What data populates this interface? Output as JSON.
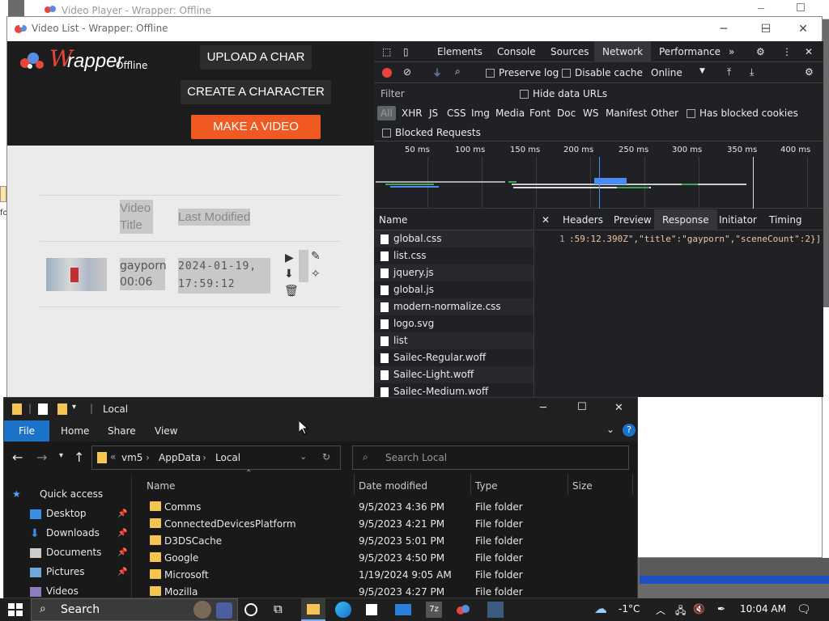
{
  "bg_window": {
    "title": "Video Player - Wrapper: Offline"
  },
  "main_window": {
    "title": "Video List - Wrapper: Offline",
    "minimize": "─",
    "maximize": "☐",
    "close": "✕"
  },
  "page": {
    "logo": {
      "w": "W",
      "rapper": "rapper",
      "offline": "Offline"
    },
    "buttons": {
      "upload": "UPLOAD A CHAR",
      "create": "CREATE A CHARACTER",
      "make": "MAKE A VIDEO"
    },
    "table": {
      "col_title": "Video Title",
      "col_modified": "Last Modified",
      "rows": [
        {
          "title": "gayporn",
          "duration": "00:06",
          "date": "2024-01-19,",
          "time": "17:59:12"
        }
      ]
    },
    "actions": {
      "play": "▶",
      "download": "⬇",
      "delete": "🗑",
      "edit": "✎",
      "magic": "✧"
    }
  },
  "devtools": {
    "tabs": [
      "Elements",
      "Console",
      "Sources",
      "Network",
      "Performance"
    ],
    "active_tab": "Network",
    "more": "»",
    "toolbar": {
      "preserve_log": "Preserve log",
      "disable_cache": "Disable cache",
      "throttle": "Online"
    },
    "filter": {
      "label": "Filter",
      "hide_data_urls": "Hide data URLs",
      "types": [
        "All",
        "XHR",
        "JS",
        "CSS",
        "Img",
        "Media",
        "Font",
        "Doc",
        "WS",
        "Manifest",
        "Other"
      ],
      "has_blocked_cookies": "Has blocked cookies",
      "blocked_requests": "Blocked Requests"
    },
    "timeline_ticks": [
      "50 ms",
      "100 ms",
      "150 ms",
      "200 ms",
      "250 ms",
      "300 ms",
      "350 ms",
      "400 ms"
    ],
    "list_header": "Name",
    "files": [
      "global.css",
      "list.css",
      "jquery.js",
      "global.js",
      "modern-normalize.css",
      "logo.svg",
      "list",
      "Sailec-Regular.woff",
      "Sailec-Light.woff",
      "Sailec-Medium.woff"
    ],
    "detail_tabs": [
      "Headers",
      "Preview",
      "Response",
      "Initiator",
      "Timing"
    ],
    "active_detail_tab": "Response",
    "response_line_no": "1",
    "response_text": ":59:12.390Z\",\"title\":\"gayporn\",\"sceneCount\":2}]"
  },
  "explorer": {
    "title": "Local",
    "ribbon": [
      "File",
      "Home",
      "Share",
      "View"
    ],
    "breadcrumb": [
      "vm5",
      "AppData",
      "Local"
    ],
    "search_placeholder": "Search Local",
    "nav": [
      "Quick access",
      "Desktop",
      "Downloads",
      "Documents",
      "Pictures",
      "Videos"
    ],
    "columns": [
      "Name",
      "Date modified",
      "Type",
      "Size"
    ],
    "rows": [
      {
        "name": "Comms",
        "date": "9/5/2023 4:36 PM",
        "type": "File folder"
      },
      {
        "name": "ConnectedDevicesPlatform",
        "date": "9/5/2023 4:21 PM",
        "type": "File folder"
      },
      {
        "name": "D3DSCache",
        "date": "9/5/2023 5:01 PM",
        "type": "File folder"
      },
      {
        "name": "Google",
        "date": "9/5/2023 4:50 PM",
        "type": "File folder"
      },
      {
        "name": "Microsoft",
        "date": "1/19/2024 9:05 AM",
        "type": "File folder"
      },
      {
        "name": "Mozilla",
        "date": "9/5/2023 4:27 PM",
        "type": "File folder"
      }
    ]
  },
  "taskbar": {
    "search": "Search",
    "weather": "-1°C",
    "time": "10:04 AM"
  },
  "colors": {
    "accent_orange": "#f05a22",
    "logo_red": "#e9453b",
    "devtools_bg": "#202124",
    "explorer_bg": "#191919",
    "folder": "#f4c550"
  }
}
